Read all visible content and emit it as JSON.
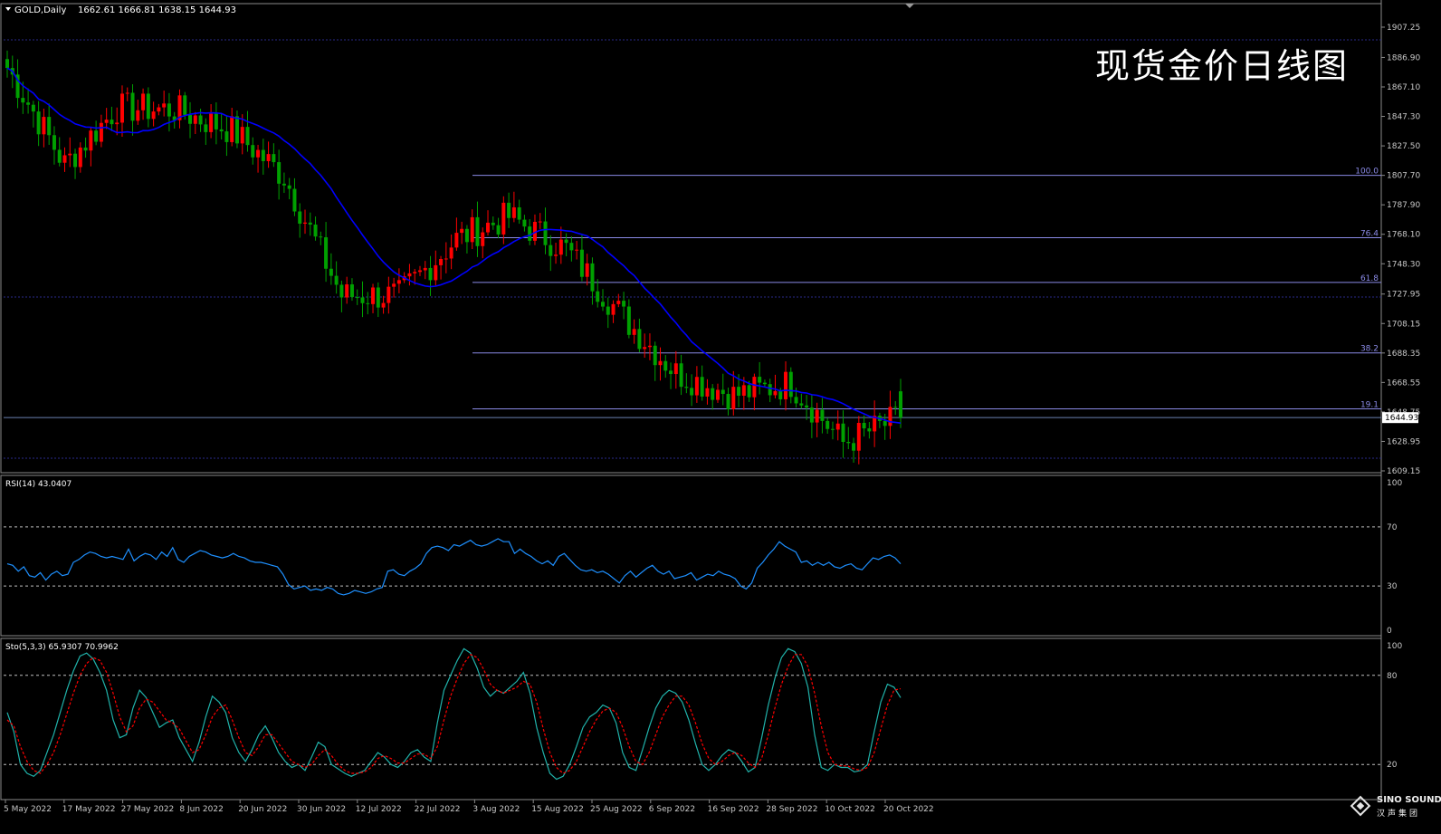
{
  "window": {
    "symbol_header": "GOLD,Daily",
    "ohlc_header": "1662.61 1666.81 1638.15 1644.93",
    "overlay_title": "现货金价日线图",
    "current_price": "1644.93"
  },
  "logo": {
    "name_en": "SINO SOUND",
    "name_cn": "汉声集团"
  },
  "colors": {
    "background": "#000000",
    "bull_candle": "#ff0000",
    "bear_candle": "#00a000",
    "moving_average": "#0000ff",
    "fib_lines": "#8a8ae6",
    "rsi_line": "#1e90ff",
    "sto_main": "#20b2aa",
    "sto_signal": "#ff0000",
    "axis_text": "#c8c8c8"
  },
  "chart_data": [
    {
      "type": "candlestick",
      "panel": "main",
      "ylim": [
        1609.15,
        1917.0
      ],
      "y_ticks": [
        "1907.25",
        "1886.90",
        "1867.10",
        "1847.30",
        "1827.50",
        "1807.70",
        "1787.90",
        "1768.10",
        "1748.30",
        "1727.95",
        "1708.15",
        "1688.35",
        "1668.55",
        "1648.75",
        "1628.95",
        "1609.15"
      ],
      "x_tick_labels": [
        "5 May 2022",
        "17 May 2022",
        "27 May 2022",
        "8 Jun 2022",
        "20 Jun 2022",
        "30 Jun 2022",
        "12 Jul 2022",
        "22 Jul 2022",
        "3 Aug 2022",
        "15 Aug 2022",
        "25 Aug 2022",
        "6 Sep 2022",
        "16 Sep 2022",
        "28 Sep 2022",
        "10 Oct 2022",
        "20 Oct 2022"
      ],
      "key_points": [
        {
          "label": "5 May 2022",
          "close": 1880
        },
        {
          "label": "17 May 2022",
          "close": 1815
        },
        {
          "label": "27 May 2022",
          "close": 1853
        },
        {
          "label": "8 Jun 2022",
          "close": 1852
        },
        {
          "label": "20 Jun 2022",
          "close": 1838
        },
        {
          "label": "30 Jun 2022",
          "close": 1807
        },
        {
          "label": "12 Jul 2022",
          "close": 1727
        },
        {
          "label": "22 Jul 2022",
          "close": 1727
        },
        {
          "label": "3 Aug 2022",
          "close": 1765
        },
        {
          "label": "15 Aug 2022",
          "close": 1780
        },
        {
          "label": "25 Aug 2022",
          "close": 1758
        },
        {
          "label": "6 Sep 2022",
          "close": 1712
        },
        {
          "label": "16 Sep 2022",
          "close": 1675
        },
        {
          "label": "28 Sep 2022",
          "close": 1660
        },
        {
          "label": "10 Oct 2022",
          "close": 1668
        },
        {
          "label": "20 Oct 2022",
          "close": 1628
        },
        {
          "label": "last",
          "close": 1644.93
        }
      ],
      "ohlc_last": {
        "open": 1662.61,
        "high": 1666.81,
        "low": 1638.15,
        "close": 1644.93
      },
      "fibonacci": [
        {
          "label": "100.0",
          "price": 1807.7
        },
        {
          "label": "76.4",
          "price": 1765.8
        },
        {
          "label": "61.8",
          "price": 1735.8
        },
        {
          "label": "38.2",
          "price": 1688.4
        },
        {
          "label": "19.1",
          "price": 1650.8
        }
      ]
    },
    {
      "type": "line",
      "panel": "rsi",
      "label": "RSI(14) 43.0407",
      "ylim": [
        0,
        100
      ],
      "y_ticks": [
        "100",
        "70",
        "30",
        "0"
      ],
      "levels": [
        70,
        30
      ],
      "values": [
        45,
        44,
        40,
        43,
        37,
        36,
        39,
        34,
        38,
        40,
        37,
        38,
        46,
        48,
        51,
        53,
        52,
        50,
        49,
        50,
        49,
        48,
        55,
        47,
        50,
        52,
        51,
        48,
        53,
        50,
        56,
        48,
        46,
        50,
        52,
        54,
        53,
        51,
        50,
        49,
        50,
        52,
        50,
        49,
        47,
        46,
        46,
        45,
        44,
        43,
        38,
        31,
        28,
        29,
        30,
        27,
        28,
        27,
        29,
        28,
        25,
        24,
        25,
        27,
        26,
        25,
        26,
        28,
        29,
        40,
        41,
        38,
        37,
        40,
        42,
        45,
        52,
        56,
        57,
        56,
        54,
        58,
        57,
        59,
        61,
        58,
        57,
        58,
        60,
        62,
        60,
        60,
        52,
        55,
        52,
        50,
        47,
        45,
        47,
        44,
        50,
        52,
        48,
        44,
        41,
        40,
        41,
        39,
        40,
        38,
        35,
        32,
        37,
        40,
        36,
        39,
        42,
        44,
        40,
        38,
        40,
        35,
        36,
        37,
        39,
        34,
        36,
        38,
        37,
        40,
        38,
        37,
        35,
        30,
        28,
        32,
        42,
        46,
        51,
        55,
        60,
        57,
        55,
        53,
        46,
        47,
        44,
        46,
        44,
        46,
        43,
        42,
        44,
        45,
        42,
        41,
        45,
        49,
        48,
        50,
        51,
        49,
        45
      ]
    },
    {
      "type": "line",
      "panel": "stochastic",
      "label": "Sto(5,3,3) 65.9307 70.9962",
      "ylim": [
        0,
        100
      ],
      "y_ticks": [
        "100",
        "80",
        "20"
      ],
      "levels": [
        80,
        20
      ],
      "series": [
        {
          "name": "main",
          "values": [
            55,
            42,
            20,
            14,
            12,
            16,
            28,
            40,
            55,
            70,
            83,
            93,
            95,
            91,
            82,
            70,
            50,
            38,
            40,
            58,
            70,
            65,
            55,
            45,
            48,
            50,
            38,
            30,
            22,
            35,
            52,
            66,
            62,
            55,
            38,
            28,
            22,
            30,
            40,
            46,
            38,
            28,
            22,
            18,
            20,
            16,
            25,
            35,
            32,
            20,
            17,
            14,
            12,
            14,
            16,
            22,
            28,
            25,
            20,
            18,
            22,
            28,
            30,
            25,
            22,
            48,
            70,
            80,
            90,
            98,
            95,
            85,
            72,
            66,
            70,
            68,
            72,
            76,
            82,
            68,
            45,
            28,
            14,
            10,
            12,
            20,
            32,
            45,
            52,
            55,
            60,
            58,
            48,
            28,
            18,
            16,
            30,
            45,
            58,
            66,
            70,
            68,
            62,
            50,
            34,
            20,
            16,
            20,
            26,
            30,
            28,
            22,
            15,
            18,
            38,
            60,
            78,
            92,
            98,
            96,
            88,
            72,
            40,
            18,
            16,
            20,
            18,
            18,
            15,
            16,
            20,
            42,
            62,
            74,
            72,
            65
          ]
        },
        {
          "name": "signal",
          "values": [
            50,
            46,
            32,
            22,
            16,
            14,
            20,
            28,
            40,
            54,
            68,
            80,
            88,
            92,
            90,
            82,
            68,
            52,
            42,
            46,
            58,
            64,
            62,
            56,
            50,
            48,
            44,
            36,
            28,
            30,
            40,
            52,
            58,
            60,
            50,
            38,
            28,
            26,
            32,
            40,
            40,
            34,
            28,
            22,
            20,
            18,
            20,
            26,
            30,
            26,
            20,
            16,
            14,
            14,
            15,
            18,
            24,
            26,
            24,
            21,
            21,
            24,
            27,
            27,
            24,
            32,
            50,
            66,
            78,
            88,
            94,
            92,
            84,
            74,
            70,
            68,
            70,
            72,
            76,
            74,
            62,
            44,
            28,
            18,
            14,
            16,
            22,
            32,
            42,
            50,
            56,
            58,
            55,
            45,
            32,
            22,
            20,
            28,
            40,
            52,
            60,
            66,
            66,
            60,
            48,
            34,
            24,
            20,
            22,
            26,
            28,
            26,
            21,
            18,
            24,
            40,
            58,
            74,
            86,
            94,
            94,
            86,
            68,
            46,
            28,
            20,
            19,
            19,
            17,
            16,
            18,
            28,
            44,
            60,
            70,
            71
          ]
        }
      ]
    }
  ]
}
